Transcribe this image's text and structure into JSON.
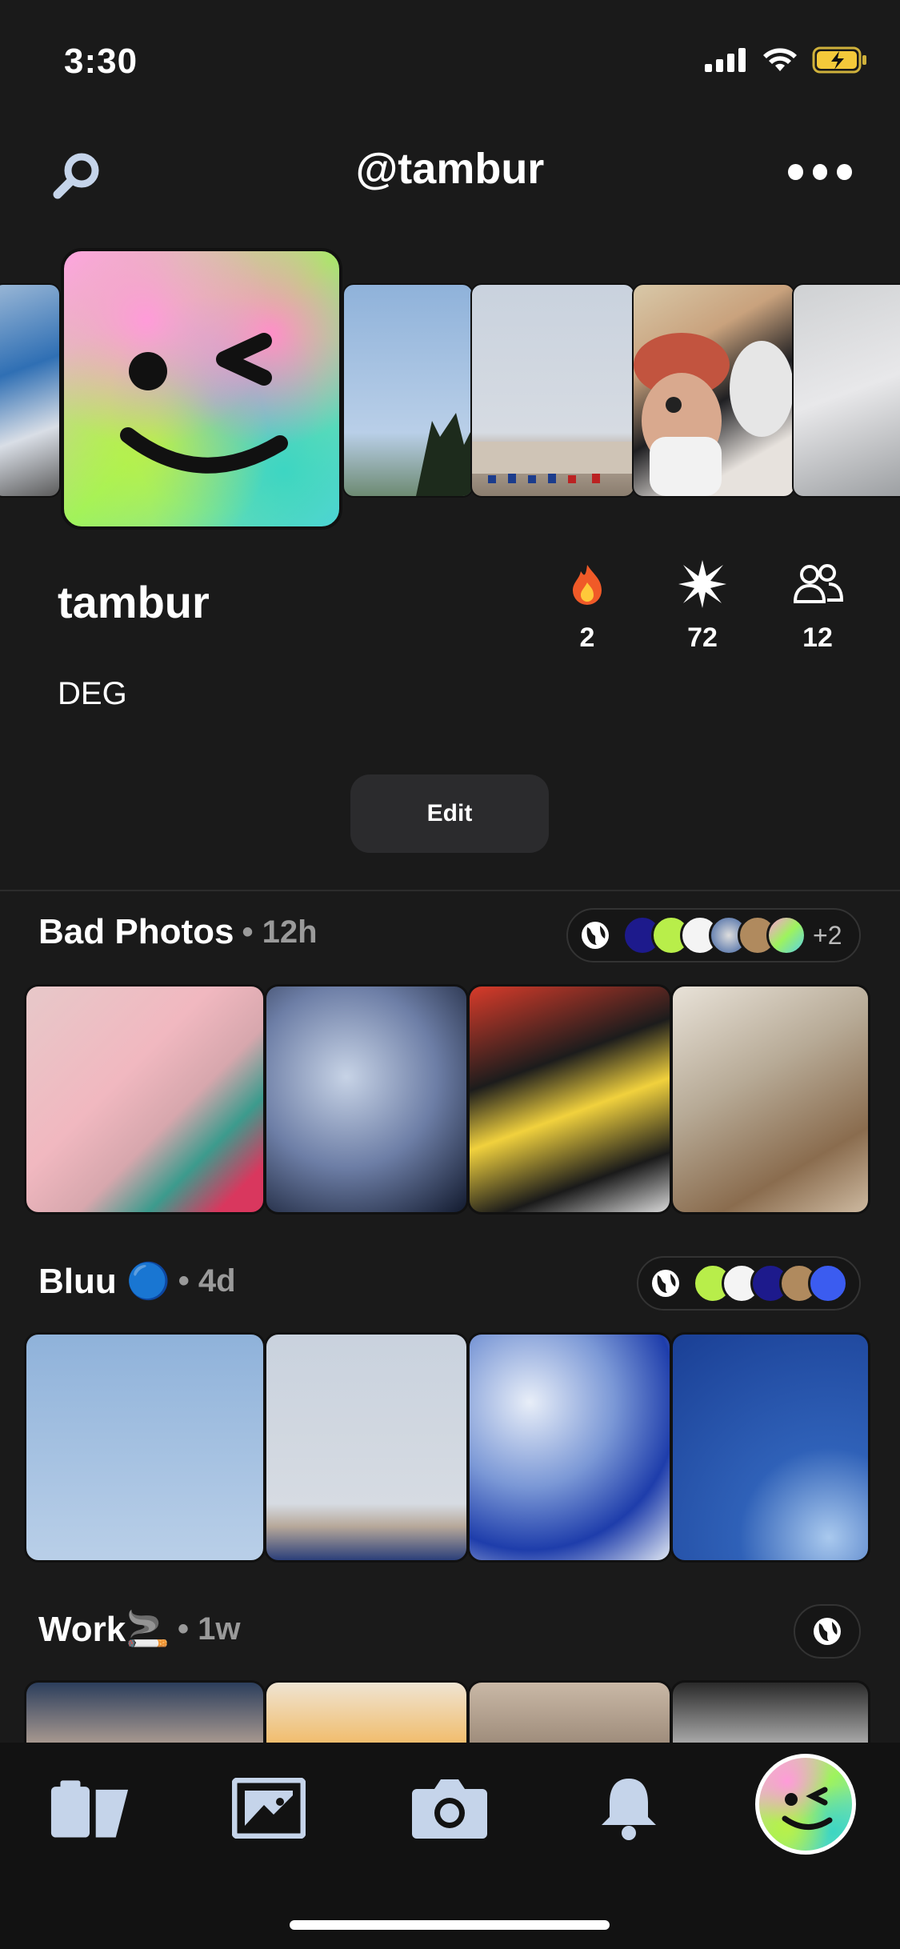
{
  "status_bar": {
    "time": "3:30"
  },
  "header": {
    "title": "@tambur"
  },
  "profile": {
    "name": "tambur",
    "bio": "DEG",
    "stats": [
      {
        "icon": "fire-icon",
        "value": "2"
      },
      {
        "icon": "sparkle-icon",
        "value": "72"
      },
      {
        "icon": "people-icon",
        "value": "12"
      }
    ],
    "edit_label": "Edit"
  },
  "albums": [
    {
      "title": "Bad Photos",
      "time": "• 12h",
      "extra_members": "+2"
    },
    {
      "title": "Bluu 🔵",
      "time": "• 4d"
    },
    {
      "title": "Work🚬",
      "time": "• 1w"
    }
  ],
  "tabbar": {
    "items": [
      "albums-icon",
      "photo-frame-icon",
      "camera-icon",
      "bell-icon",
      "profile-avatar"
    ]
  },
  "colors": {
    "background": "#1a1a1a",
    "tab_icon": "#c5d4ea",
    "pill_border": "#333333"
  }
}
